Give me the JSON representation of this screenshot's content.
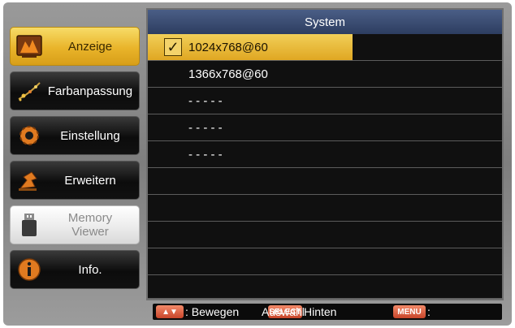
{
  "sidebar": {
    "items": [
      {
        "label": "Anzeige",
        "icon": "display-icon",
        "state": "selected"
      },
      {
        "label": "Farbanpassung",
        "icon": "color-adjust-icon",
        "state": "normal"
      },
      {
        "label": "Einstellung",
        "icon": "settings-gear-icon",
        "state": "normal"
      },
      {
        "label": "Erweitern",
        "icon": "extend-icon",
        "state": "normal"
      },
      {
        "label": "Memory\nViewer",
        "icon": "usb-drive-icon",
        "state": "disabled"
      },
      {
        "label": "Info.",
        "icon": "info-icon",
        "state": "normal"
      }
    ]
  },
  "panel": {
    "title": "System",
    "rows": [
      {
        "text": "1024x768@60",
        "selected": true,
        "check": "✓"
      },
      {
        "text": "1366x768@60",
        "selected": false
      },
      {
        "text": "- - - - -",
        "selected": false
      },
      {
        "text": "- - - - -",
        "selected": false
      },
      {
        "text": "- - - - -",
        "selected": false
      },
      {
        "text": "",
        "selected": false
      },
      {
        "text": "",
        "selected": false
      },
      {
        "text": "",
        "selected": false
      },
      {
        "text": "",
        "selected": false
      },
      {
        "text": "",
        "selected": false
      }
    ]
  },
  "statusbar": {
    "move_key": "▲▼",
    "move_label": ": Bewegen",
    "select_label": "Auswahl",
    "select_key": "SELECT",
    "back_label": "Hinten",
    "menu_key": "MENU",
    "menu_label": ":"
  },
  "colors": {
    "accent": "#e9b42a",
    "title_bar": "#3a4c73",
    "panel_bg": "#0d0d0d",
    "key_button": "#d9593a"
  }
}
